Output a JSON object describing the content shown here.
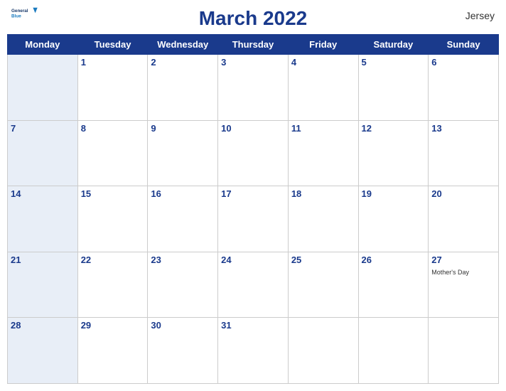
{
  "header": {
    "title": "March 2022",
    "region": "Jersey",
    "logo_line1": "General",
    "logo_line2": "Blue"
  },
  "days": [
    "Monday",
    "Tuesday",
    "Wednesday",
    "Thursday",
    "Friday",
    "Saturday",
    "Sunday"
  ],
  "weeks": [
    [
      {
        "date": "",
        "event": ""
      },
      {
        "date": "1",
        "event": ""
      },
      {
        "date": "2",
        "event": ""
      },
      {
        "date": "3",
        "event": ""
      },
      {
        "date": "4",
        "event": ""
      },
      {
        "date": "5",
        "event": ""
      },
      {
        "date": "6",
        "event": ""
      }
    ],
    [
      {
        "date": "7",
        "event": ""
      },
      {
        "date": "8",
        "event": ""
      },
      {
        "date": "9",
        "event": ""
      },
      {
        "date": "10",
        "event": ""
      },
      {
        "date": "11",
        "event": ""
      },
      {
        "date": "12",
        "event": ""
      },
      {
        "date": "13",
        "event": ""
      }
    ],
    [
      {
        "date": "14",
        "event": ""
      },
      {
        "date": "15",
        "event": ""
      },
      {
        "date": "16",
        "event": ""
      },
      {
        "date": "17",
        "event": ""
      },
      {
        "date": "18",
        "event": ""
      },
      {
        "date": "19",
        "event": ""
      },
      {
        "date": "20",
        "event": ""
      }
    ],
    [
      {
        "date": "21",
        "event": ""
      },
      {
        "date": "22",
        "event": ""
      },
      {
        "date": "23",
        "event": ""
      },
      {
        "date": "24",
        "event": ""
      },
      {
        "date": "25",
        "event": ""
      },
      {
        "date": "26",
        "event": ""
      },
      {
        "date": "27",
        "event": "Mother's Day"
      }
    ],
    [
      {
        "date": "28",
        "event": ""
      },
      {
        "date": "29",
        "event": ""
      },
      {
        "date": "30",
        "event": ""
      },
      {
        "date": "31",
        "event": ""
      },
      {
        "date": "",
        "event": ""
      },
      {
        "date": "",
        "event": ""
      },
      {
        "date": "",
        "event": ""
      }
    ]
  ]
}
